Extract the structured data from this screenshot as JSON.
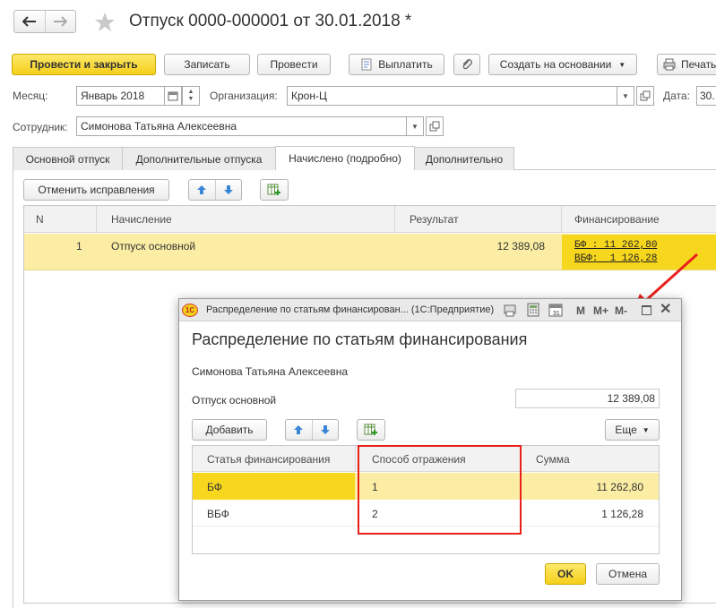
{
  "window": {
    "title": "Отпуск 0000-000001 от 30.01.2018 *"
  },
  "toolbar": {
    "post_close": "Провести и закрыть",
    "save": "Записать",
    "post": "Провести",
    "pay": "Выплатить",
    "create_based": "Создать на основании",
    "print": "Печать"
  },
  "fields": {
    "month_label": "Месяц:",
    "month_value": "Январь 2018",
    "org_label": "Организация:",
    "org_value": "Крон-Ц",
    "date_label": "Дата:",
    "date_value": "30.",
    "employee_label": "Сотрудник:",
    "employee_value": "Симонова Татьяна Алексеевна"
  },
  "tabs": [
    {
      "label": "Основной отпуск"
    },
    {
      "label": "Дополнительные отпуска"
    },
    {
      "label": "Начислено (подробно)"
    },
    {
      "label": "Дополнительно"
    }
  ],
  "main_table": {
    "cancel_corrections": "Отменить исправления",
    "headers": [
      "N",
      "Начисление",
      "Результат",
      "Финансирование"
    ],
    "rows": [
      {
        "n": "1",
        "accrual": "Отпуск основной",
        "result": "12 389,08",
        "fin_line1": "БФ : 11 262,80",
        "fin_line2": "ВБФ:  1 126,28"
      }
    ]
  },
  "dialog": {
    "titlebar": "Распределение по статьям финансирован... (1С:Предприятие)",
    "app_badge": "1С",
    "m": "M",
    "mplus": "M+",
    "mminus": "M-",
    "heading": "Распределение по статьям финансирования",
    "employee": "Симонова Татьяна Алексеевна",
    "accrual_label": "Отпуск основной",
    "accrual_amount": "12 389,08",
    "add": "Добавить",
    "more": "Еще",
    "headers": [
      "Статья финансирования",
      "Способ отражения",
      "Сумма"
    ],
    "rows": [
      {
        "article": "БФ",
        "method": "1",
        "sum": "11 262,80"
      },
      {
        "article": "ВБФ",
        "method": "2",
        "sum": "1 126,28"
      }
    ],
    "ok": "OK",
    "cancel": "Отмена"
  },
  "colors": {
    "accent_yellow": "#f5cf1a",
    "row_highlight": "#fbeea4",
    "annotation_red": "#e8201c"
  }
}
